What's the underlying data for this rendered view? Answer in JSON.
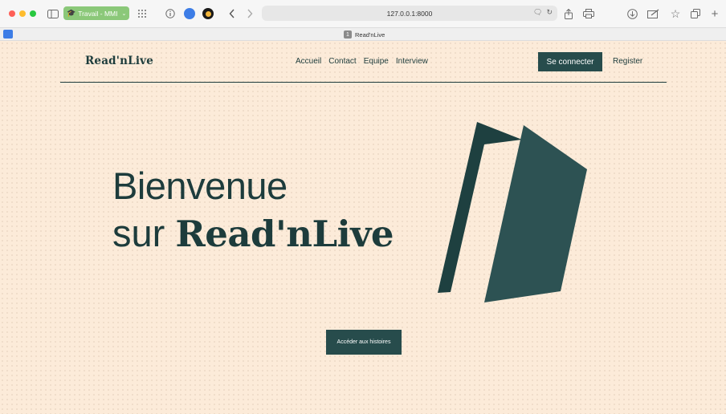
{
  "browser": {
    "group_label": "Travail - MMI",
    "url": "127.0.0.1:8000",
    "tab_title": "Read'nLive",
    "tab_number": "1"
  },
  "header": {
    "logo": "Read'nLive",
    "nav": [
      "Accueil",
      "Contact",
      "Equipe",
      "Interview"
    ],
    "connect_label": "Se connecter",
    "register_label": "Register"
  },
  "hero": {
    "line1": "Bienvenue",
    "line2_prefix": "sur ",
    "line2_brand": "Read'nLive",
    "cta_label": "Accéder aux histoires"
  },
  "colors": {
    "primary": "#274c4c",
    "background": "#fcebd9",
    "tab_group": "#8bc879"
  }
}
